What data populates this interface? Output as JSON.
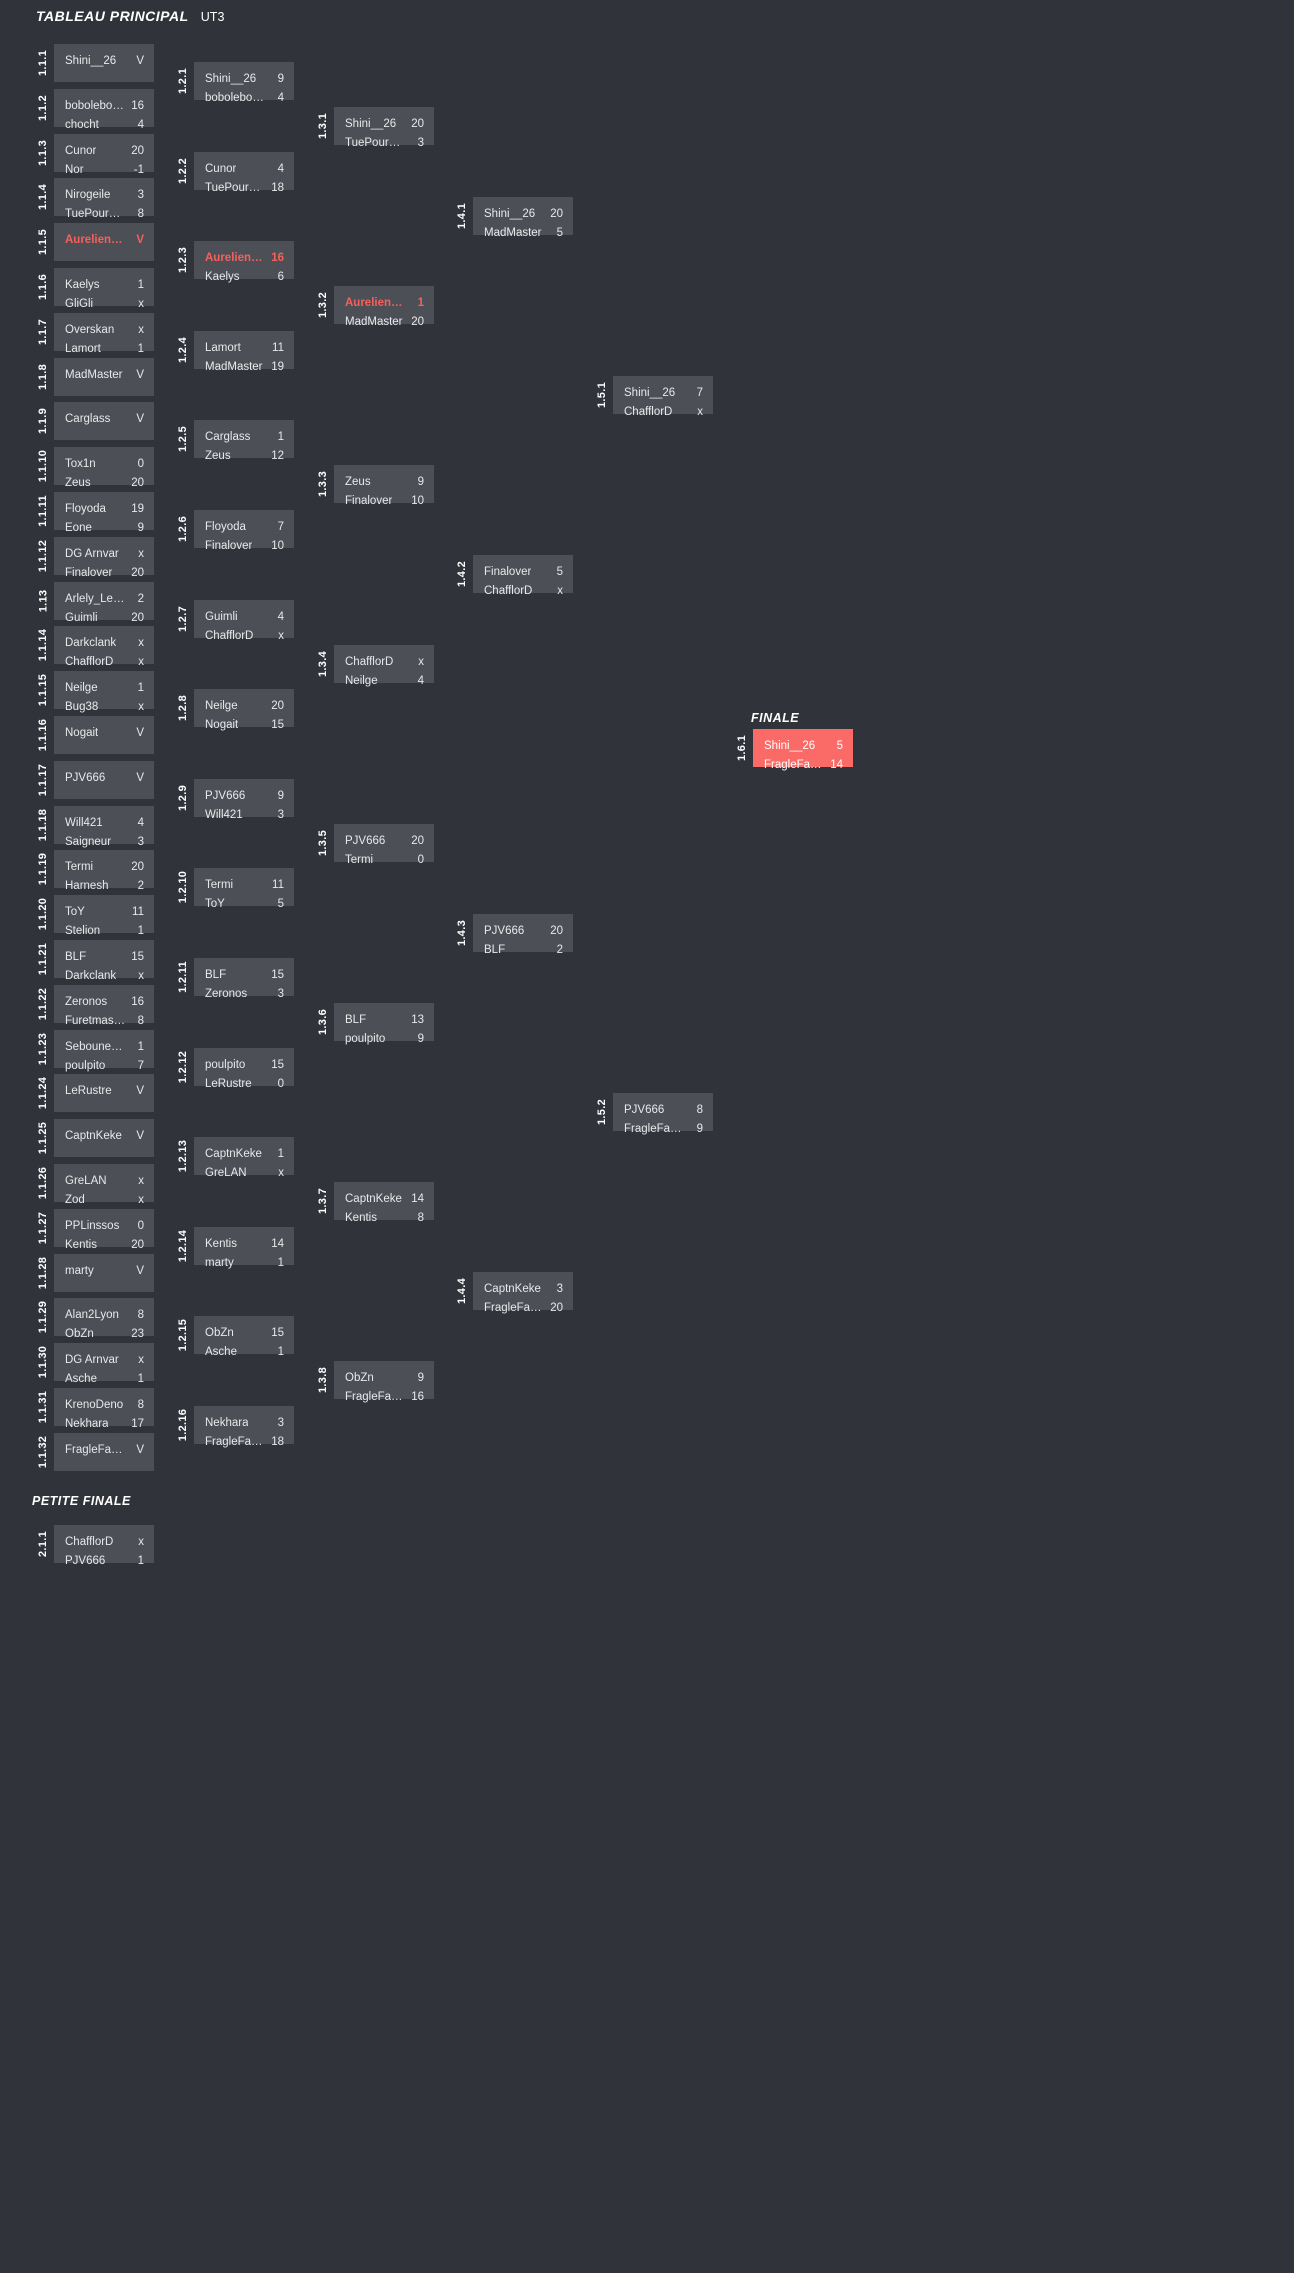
{
  "headers": {
    "main": "TABLEAU PRINCIPAL",
    "main_sub": "UT3",
    "final": "FINALE",
    "petite_finale": "PETITE FINALE"
  },
  "colors": {
    "background": "#303339",
    "box": "#4c4f56",
    "accent": "#f4615c",
    "final_box": "#fa6a66",
    "text": "#e8e9ea"
  },
  "matches": [
    {
      "id": "1.1.1",
      "col": 0,
      "idx": 0,
      "p1": {
        "name": "Shini__26",
        "score": "V"
      },
      "p2": {
        "name": "",
        "score": ""
      }
    },
    {
      "id": "1.1.2",
      "col": 0,
      "idx": 1,
      "p1": {
        "name": "bobolebonbon…",
        "score": "16"
      },
      "p2": {
        "name": "chocht",
        "score": "4"
      }
    },
    {
      "id": "1.1.3",
      "col": 0,
      "idx": 2,
      "p1": {
        "name": "Cunor",
        "score": "20"
      },
      "p2": {
        "name": "Nor",
        "score": "-1"
      }
    },
    {
      "id": "1.1.4",
      "col": 0,
      "idx": 3,
      "p1": {
        "name": "Nirogeile",
        "score": "3"
      },
      "p2": {
        "name": "TuePourManger",
        "score": "8"
      }
    },
    {
      "id": "1.1.5",
      "col": 0,
      "idx": 4,
      "p1": {
        "name": "Aurelienazerty",
        "score": "V",
        "win": true
      },
      "p2": {
        "name": "",
        "score": ""
      }
    },
    {
      "id": "1.1.6",
      "col": 0,
      "idx": 5,
      "p1": {
        "name": "Kaelys",
        "score": "1"
      },
      "p2": {
        "name": "GliGli",
        "score": "x"
      }
    },
    {
      "id": "1.1.7",
      "col": 0,
      "idx": 6,
      "p1": {
        "name": "Overskan",
        "score": "x"
      },
      "p2": {
        "name": "Lamort",
        "score": "1"
      }
    },
    {
      "id": "1.1.8",
      "col": 0,
      "idx": 7,
      "p1": {
        "name": "MadMaster",
        "score": "V"
      },
      "p2": {
        "name": "",
        "score": ""
      }
    },
    {
      "id": "1.1.9",
      "col": 0,
      "idx": 8,
      "p1": {
        "name": "Carglass",
        "score": "V"
      },
      "p2": {
        "name": "",
        "score": ""
      }
    },
    {
      "id": "1.1.10",
      "col": 0,
      "idx": 9,
      "p1": {
        "name": "Tox1n",
        "score": "0"
      },
      "p2": {
        "name": "Zeus",
        "score": "20"
      }
    },
    {
      "id": "1.1.11",
      "col": 0,
      "idx": 10,
      "p1": {
        "name": "Floyoda",
        "score": "19"
      },
      "p2": {
        "name": "Eone",
        "score": "9"
      }
    },
    {
      "id": "1.1.12",
      "col": 0,
      "idx": 11,
      "p1": {
        "name": "DG Arnvar",
        "score": "x"
      },
      "p2": {
        "name": "Finalover",
        "score": "20"
      }
    },
    {
      "id": "1.13",
      "col": 0,
      "idx": 12,
      "p1": {
        "name": "Arlely_Le_Zen",
        "score": "2"
      },
      "p2": {
        "name": "Guimli",
        "score": "20"
      }
    },
    {
      "id": "1.1.14",
      "col": 0,
      "idx": 13,
      "p1": {
        "name": "Darkclank",
        "score": "x"
      },
      "p2": {
        "name": "ChafflorD",
        "score": "x"
      }
    },
    {
      "id": "1.1.15",
      "col": 0,
      "idx": 14,
      "p1": {
        "name": "Neilge",
        "score": "1"
      },
      "p2": {
        "name": "Bug38",
        "score": "x"
      }
    },
    {
      "id": "1.1.16",
      "col": 0,
      "idx": 15,
      "p1": {
        "name": "Nogait",
        "score": "V"
      },
      "p2": {
        "name": "",
        "score": ""
      }
    },
    {
      "id": "1.1.17",
      "col": 0,
      "idx": 16,
      "p1": {
        "name": "PJV666",
        "score": "V"
      },
      "p2": {
        "name": "",
        "score": ""
      }
    },
    {
      "id": "1.1.18",
      "col": 0,
      "idx": 17,
      "p1": {
        "name": "Will421",
        "score": "4"
      },
      "p2": {
        "name": "Saigneur",
        "score": "3"
      }
    },
    {
      "id": "1.1.19",
      "col": 0,
      "idx": 18,
      "p1": {
        "name": "Termi",
        "score": "20"
      },
      "p2": {
        "name": "Harnesh",
        "score": "2"
      }
    },
    {
      "id": "1.1.20",
      "col": 0,
      "idx": 19,
      "p1": {
        "name": "ToY",
        "score": "11"
      },
      "p2": {
        "name": "Stelion",
        "score": "1"
      }
    },
    {
      "id": "1.1.21",
      "col": 0,
      "idx": 20,
      "p1": {
        "name": "BLF",
        "score": "15"
      },
      "p2": {
        "name": "Darkclank",
        "score": "x"
      }
    },
    {
      "id": "1.1.22",
      "col": 0,
      "idx": 21,
      "p1": {
        "name": "Zeronos",
        "score": "16"
      },
      "p2": {
        "name": "Furetmaster",
        "score": "8"
      }
    },
    {
      "id": "1.1.23",
      "col": 0,
      "idx": 22,
      "p1": {
        "name": "Sebouney[FR]",
        "score": "1"
      },
      "p2": {
        "name": "poulpito",
        "score": "7"
      }
    },
    {
      "id": "1.1.24",
      "col": 0,
      "idx": 23,
      "p1": {
        "name": "LeRustre",
        "score": "V"
      },
      "p2": {
        "name": "",
        "score": ""
      }
    },
    {
      "id": "1.1.25",
      "col": 0,
      "idx": 24,
      "p1": {
        "name": "CaptnKeke",
        "score": "V"
      },
      "p2": {
        "name": "",
        "score": ""
      }
    },
    {
      "id": "1.1.26",
      "col": 0,
      "idx": 25,
      "p1": {
        "name": "GreLAN",
        "score": "x"
      },
      "p2": {
        "name": "Zod",
        "score": "x"
      }
    },
    {
      "id": "1.1.27",
      "col": 0,
      "idx": 26,
      "p1": {
        "name": "PPLinssos",
        "score": "0"
      },
      "p2": {
        "name": "Kentis",
        "score": "20"
      }
    },
    {
      "id": "1.1.28",
      "col": 0,
      "idx": 27,
      "p1": {
        "name": "marty",
        "score": "V"
      },
      "p2": {
        "name": "",
        "score": ""
      }
    },
    {
      "id": "1.1.29",
      "col": 0,
      "idx": 28,
      "p1": {
        "name": "Alan2Lyon",
        "score": "8"
      },
      "p2": {
        "name": "ObZn",
        "score": "23"
      }
    },
    {
      "id": "1.1.30",
      "col": 0,
      "idx": 29,
      "p1": {
        "name": "DG Arnvar",
        "score": "x"
      },
      "p2": {
        "name": "Asche",
        "score": "1"
      }
    },
    {
      "id": "1.1.31",
      "col": 0,
      "idx": 30,
      "p1": {
        "name": "KrenoDeno",
        "score": "8"
      },
      "p2": {
        "name": "Nekhara",
        "score": "17"
      }
    },
    {
      "id": "1.1.32",
      "col": 0,
      "idx": 31,
      "p1": {
        "name": "FragleFameux",
        "score": "V"
      },
      "p2": {
        "name": "",
        "score": ""
      }
    },
    {
      "id": "1.2.1",
      "col": 1,
      "idx": 0,
      "p1": {
        "name": "Shini__26",
        "score": "9"
      },
      "p2": {
        "name": "bobolebonbon…",
        "score": "4"
      }
    },
    {
      "id": "1.2.2",
      "col": 1,
      "idx": 1,
      "p1": {
        "name": "Cunor",
        "score": "4"
      },
      "p2": {
        "name": "TuePourManger",
        "score": "18"
      }
    },
    {
      "id": "1.2.3",
      "col": 1,
      "idx": 2,
      "p1": {
        "name": "Aurelienazerty",
        "score": "16",
        "win": true
      },
      "p2": {
        "name": "Kaelys",
        "score": "6"
      }
    },
    {
      "id": "1.2.4",
      "col": 1,
      "idx": 3,
      "p1": {
        "name": "Lamort",
        "score": "11"
      },
      "p2": {
        "name": "MadMaster",
        "score": "19"
      }
    },
    {
      "id": "1.2.5",
      "col": 1,
      "idx": 4,
      "p1": {
        "name": "Carglass",
        "score": "1"
      },
      "p2": {
        "name": "Zeus",
        "score": "12"
      }
    },
    {
      "id": "1.2.6",
      "col": 1,
      "idx": 5,
      "p1": {
        "name": "Floyoda",
        "score": "7"
      },
      "p2": {
        "name": "Finalover",
        "score": "10"
      }
    },
    {
      "id": "1.2.7",
      "col": 1,
      "idx": 6,
      "p1": {
        "name": "Guimli",
        "score": "4"
      },
      "p2": {
        "name": "ChafflorD",
        "score": "x"
      }
    },
    {
      "id": "1.2.8",
      "col": 1,
      "idx": 7,
      "p1": {
        "name": "Neilge",
        "score": "20"
      },
      "p2": {
        "name": "Nogait",
        "score": "15"
      }
    },
    {
      "id": "1.2.9",
      "col": 1,
      "idx": 8,
      "p1": {
        "name": "PJV666",
        "score": "9"
      },
      "p2": {
        "name": "Will421",
        "score": "3"
      }
    },
    {
      "id": "1.2.10",
      "col": 1,
      "idx": 9,
      "p1": {
        "name": "Termi",
        "score": "11"
      },
      "p2": {
        "name": "ToY",
        "score": "5"
      }
    },
    {
      "id": "1.2.11",
      "col": 1,
      "idx": 10,
      "p1": {
        "name": "BLF",
        "score": "15"
      },
      "p2": {
        "name": "Zeronos",
        "score": "3"
      }
    },
    {
      "id": "1.2.12",
      "col": 1,
      "idx": 11,
      "p1": {
        "name": "poulpito",
        "score": "15"
      },
      "p2": {
        "name": "LeRustre",
        "score": "0"
      }
    },
    {
      "id": "1.2.13",
      "col": 1,
      "idx": 12,
      "p1": {
        "name": "CaptnKeke",
        "score": "1"
      },
      "p2": {
        "name": "GreLAN",
        "score": "x"
      }
    },
    {
      "id": "1.2.14",
      "col": 1,
      "idx": 13,
      "p1": {
        "name": "Kentis",
        "score": "14"
      },
      "p2": {
        "name": "marty",
        "score": "1"
      }
    },
    {
      "id": "1.2.15",
      "col": 1,
      "idx": 14,
      "p1": {
        "name": "ObZn",
        "score": "15"
      },
      "p2": {
        "name": "Asche",
        "score": "1"
      }
    },
    {
      "id": "1.2.16",
      "col": 1,
      "idx": 15,
      "p1": {
        "name": "Nekhara",
        "score": "3"
      },
      "p2": {
        "name": "FragleFameux",
        "score": "18"
      }
    },
    {
      "id": "1.3.1",
      "col": 2,
      "idx": 0,
      "p1": {
        "name": "Shini__26",
        "score": "20"
      },
      "p2": {
        "name": "TuePourManger",
        "score": "3"
      }
    },
    {
      "id": "1.3.2",
      "col": 2,
      "idx": 1,
      "p1": {
        "name": "Aurelienazerty",
        "score": "1",
        "win": true
      },
      "p2": {
        "name": "MadMaster",
        "score": "20"
      }
    },
    {
      "id": "1.3.3",
      "col": 2,
      "idx": 2,
      "p1": {
        "name": "Zeus",
        "score": "9"
      },
      "p2": {
        "name": "Finalover",
        "score": "10"
      }
    },
    {
      "id": "1.3.4",
      "col": 2,
      "idx": 3,
      "p1": {
        "name": "ChafflorD",
        "score": "x"
      },
      "p2": {
        "name": "Neilge",
        "score": "4"
      }
    },
    {
      "id": "1.3.5",
      "col": 2,
      "idx": 4,
      "p1": {
        "name": "PJV666",
        "score": "20"
      },
      "p2": {
        "name": "Termi",
        "score": "0"
      }
    },
    {
      "id": "1.3.6",
      "col": 2,
      "idx": 5,
      "p1": {
        "name": "BLF",
        "score": "13"
      },
      "p2": {
        "name": "poulpito",
        "score": "9"
      }
    },
    {
      "id": "1.3.7",
      "col": 2,
      "idx": 6,
      "p1": {
        "name": "CaptnKeke",
        "score": "14"
      },
      "p2": {
        "name": "Kentis",
        "score": "8"
      }
    },
    {
      "id": "1.3.8",
      "col": 2,
      "idx": 7,
      "p1": {
        "name": "ObZn",
        "score": "9"
      },
      "p2": {
        "name": "FragleFameux",
        "score": "16"
      }
    },
    {
      "id": "1.4.1",
      "col": 3,
      "idx": 0,
      "p1": {
        "name": "Shini__26",
        "score": "20"
      },
      "p2": {
        "name": "MadMaster",
        "score": "5"
      }
    },
    {
      "id": "1.4.2",
      "col": 3,
      "idx": 1,
      "p1": {
        "name": "Finalover",
        "score": "5"
      },
      "p2": {
        "name": "ChafflorD",
        "score": "x"
      }
    },
    {
      "id": "1.4.3",
      "col": 3,
      "idx": 2,
      "p1": {
        "name": "PJV666",
        "score": "20"
      },
      "p2": {
        "name": "BLF",
        "score": "2"
      }
    },
    {
      "id": "1.4.4",
      "col": 3,
      "idx": 3,
      "p1": {
        "name": "CaptnKeke",
        "score": "3"
      },
      "p2": {
        "name": "FragleFameux",
        "score": "20"
      }
    },
    {
      "id": "1.5.1",
      "col": 4,
      "idx": 0,
      "p1": {
        "name": "Shini__26",
        "score": "7"
      },
      "p2": {
        "name": "ChafflorD",
        "score": "x"
      }
    },
    {
      "id": "1.5.2",
      "col": 4,
      "idx": 1,
      "p1": {
        "name": "PJV666",
        "score": "8"
      },
      "p2": {
        "name": "FragleFameux",
        "score": "9"
      }
    },
    {
      "id": "1.6.1",
      "col": 5,
      "idx": 0,
      "final": true,
      "p1": {
        "name": "Shini__26",
        "score": "5"
      },
      "p2": {
        "name": "FragleFameux",
        "score": "14"
      }
    },
    {
      "id": "2.1.1",
      "col": 6,
      "idx": 0,
      "p1": {
        "name": "ChafflorD",
        "score": "x"
      },
      "p2": {
        "name": "PJV666",
        "score": "1"
      }
    }
  ]
}
